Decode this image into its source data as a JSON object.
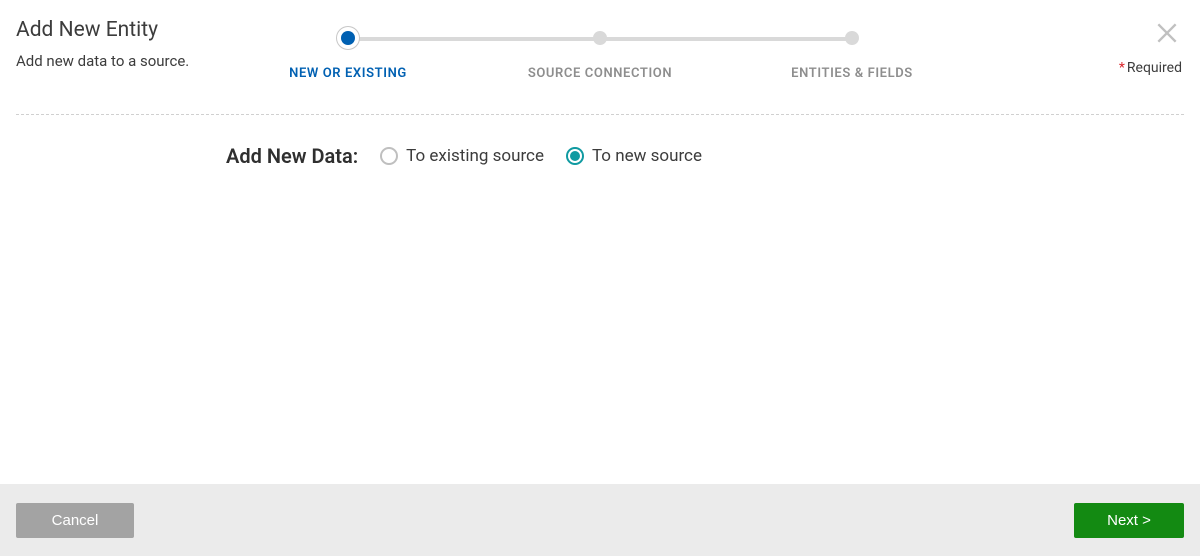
{
  "header": {
    "title": "Add New Entity",
    "subtitle": "Add new data to a source.",
    "required_label": "Required"
  },
  "stepper": {
    "steps": [
      {
        "label": "NEW OR EXISTING",
        "active": true
      },
      {
        "label": "SOURCE CONNECTION",
        "active": false
      },
      {
        "label": "ENTITIES & FIELDS",
        "active": false
      }
    ]
  },
  "form": {
    "question_label": "Add New Data:",
    "options": {
      "existing": {
        "label": "To existing source",
        "selected": false
      },
      "new": {
        "label": "To new source",
        "selected": true
      }
    }
  },
  "footer": {
    "cancel": "Cancel",
    "next": "Next >"
  },
  "colors": {
    "primary_blue": "#0060b2",
    "accent_teal": "#0f9aa1",
    "next_green": "#138a12",
    "cancel_gray": "#a3a3a3"
  }
}
